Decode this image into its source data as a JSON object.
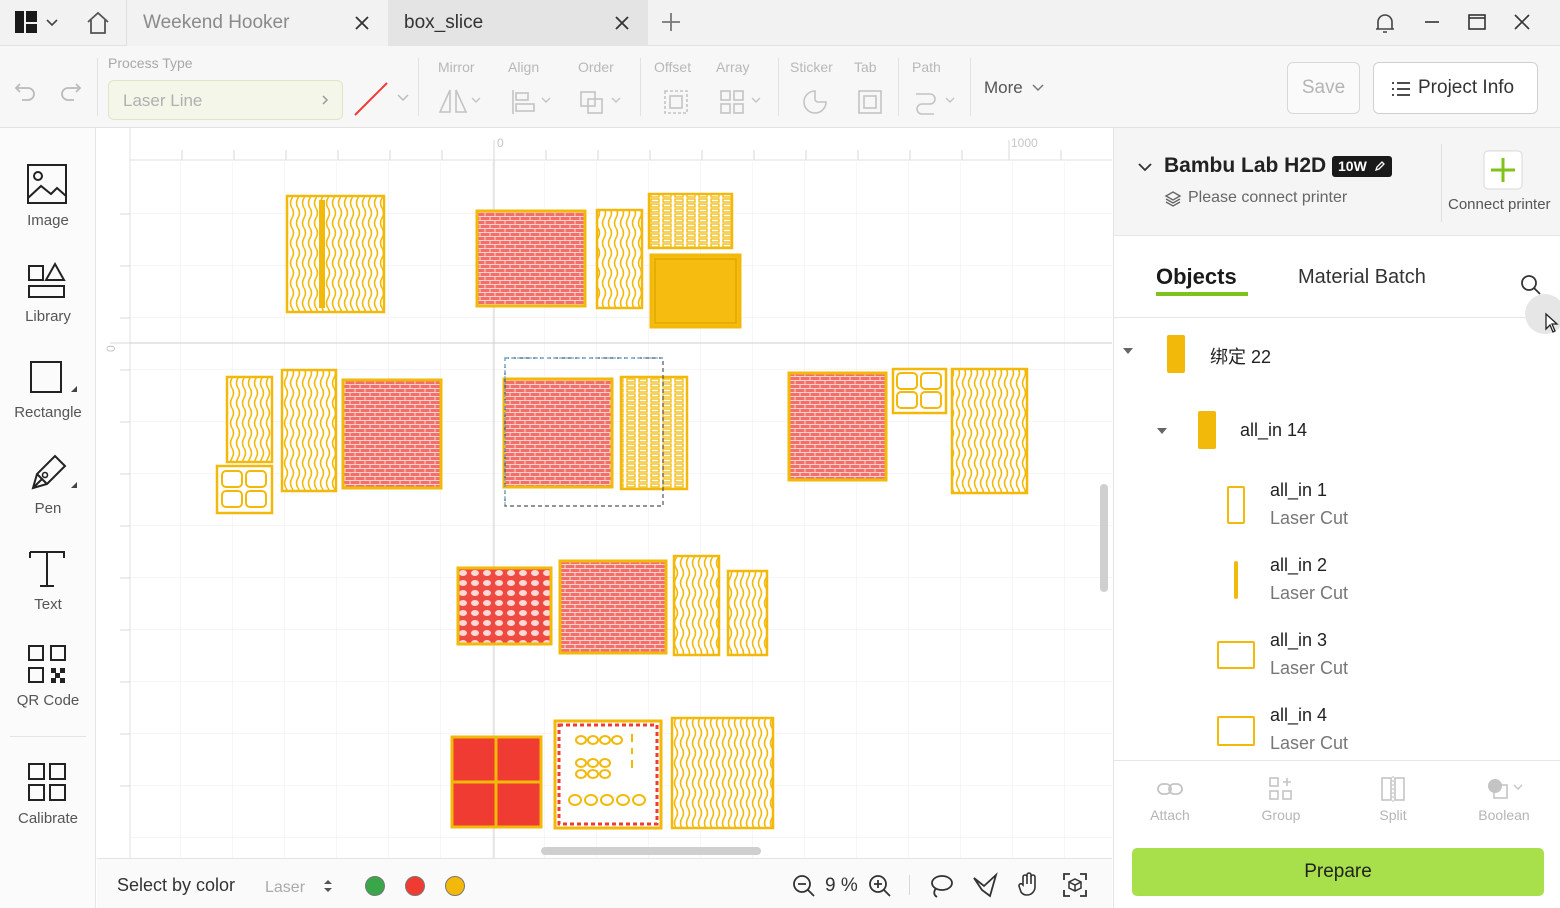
{
  "tabs": [
    {
      "label": "Weekend Hooker"
    },
    {
      "label": "box_slice"
    }
  ],
  "toolbar": {
    "process_type_label": "Process Type",
    "process_type_value": "Laser Line",
    "groups": {
      "mirror": "Mirror",
      "align": "Align",
      "order": "Order",
      "offset": "Offset",
      "array": "Array",
      "sticker": "Sticker",
      "tab": "Tab",
      "path": "Path"
    },
    "more_label": "More",
    "save_label": "Save",
    "project_info_label": "Project Info"
  },
  "left_tools": [
    {
      "label": "Image",
      "icon": "image-icon"
    },
    {
      "label": "Library",
      "icon": "library-icon"
    },
    {
      "label": "Rectangle",
      "icon": "rectangle-icon"
    },
    {
      "label": "Pen",
      "icon": "pen-icon"
    },
    {
      "label": "Text",
      "icon": "text-icon"
    },
    {
      "label": "QR Code",
      "icon": "qr-code-icon"
    },
    {
      "label": "Calibrate",
      "icon": "calibrate-icon"
    }
  ],
  "canvas": {
    "ruler_top_labels": [
      "0",
      "1000"
    ],
    "ruler_left_labels": [
      "0"
    ]
  },
  "bottombar": {
    "select_by_color_label": "Select by color",
    "laser_select_value": "Laser",
    "color_dots": [
      "#3aa64a",
      "#ef3b32",
      "#f2b90a"
    ],
    "zoom_value": "9 %"
  },
  "printer": {
    "name": "Bambu Lab H2D",
    "badge": "10W",
    "status": "Please connect printer",
    "connect_label": "Connect printer"
  },
  "panel_tabs": {
    "objects": "Objects",
    "material_batch": "Material Batch"
  },
  "objects": [
    {
      "name": "绑定 22",
      "sub": ""
    },
    {
      "name": "all_in 14",
      "sub": ""
    },
    {
      "name": "all_in 1",
      "sub": "Laser Cut"
    },
    {
      "name": "all_in 2",
      "sub": "Laser Cut"
    },
    {
      "name": "all_in 3",
      "sub": "Laser Cut"
    },
    {
      "name": "all_in 4",
      "sub": "Laser Cut"
    }
  ],
  "actions": {
    "attach": "Attach",
    "group": "Group",
    "split": "Split",
    "boolean": "Boolean"
  },
  "prepare_label": "Prepare",
  "colors": {
    "accent": "#a7e04a",
    "piece_outline": "#f2b90a",
    "piece_fill_red": "#ef3b32"
  }
}
